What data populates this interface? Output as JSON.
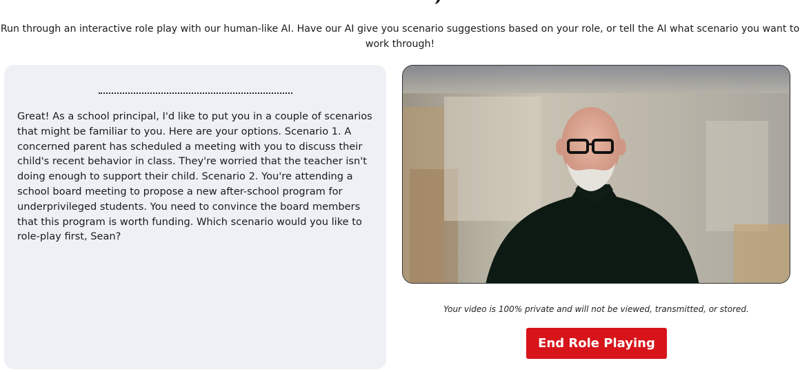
{
  "intro": {
    "text": "Run through an interactive role play with our human-like AI. Have our AI give you scenario suggestions based on your role, or tell the AI what scenario you want to work through!"
  },
  "chat": {
    "message": "Great! As a school principal, I'd like to put you in a couple of scenarios that might be familiar to you. Here are your options. Scenario 1. A concerned parent has scheduled a meeting with you to discuss their child's recent behavior in class. They're worried that the teacher isn't doing enough to support their child. Scenario 2. You're attending a school board meeting to propose a new after-school program for underprivileged students. You need to convince the board members that this program is worth funding. Which scenario would you like to role-play first, Sean?"
  },
  "video": {
    "privacy_note": "Your video is 100% private and will not be viewed, transmitted, or stored."
  },
  "actions": {
    "end_label": "End Role Playing"
  },
  "colors": {
    "accent": "#d7141a",
    "panel_bg": "#eef0f5"
  }
}
